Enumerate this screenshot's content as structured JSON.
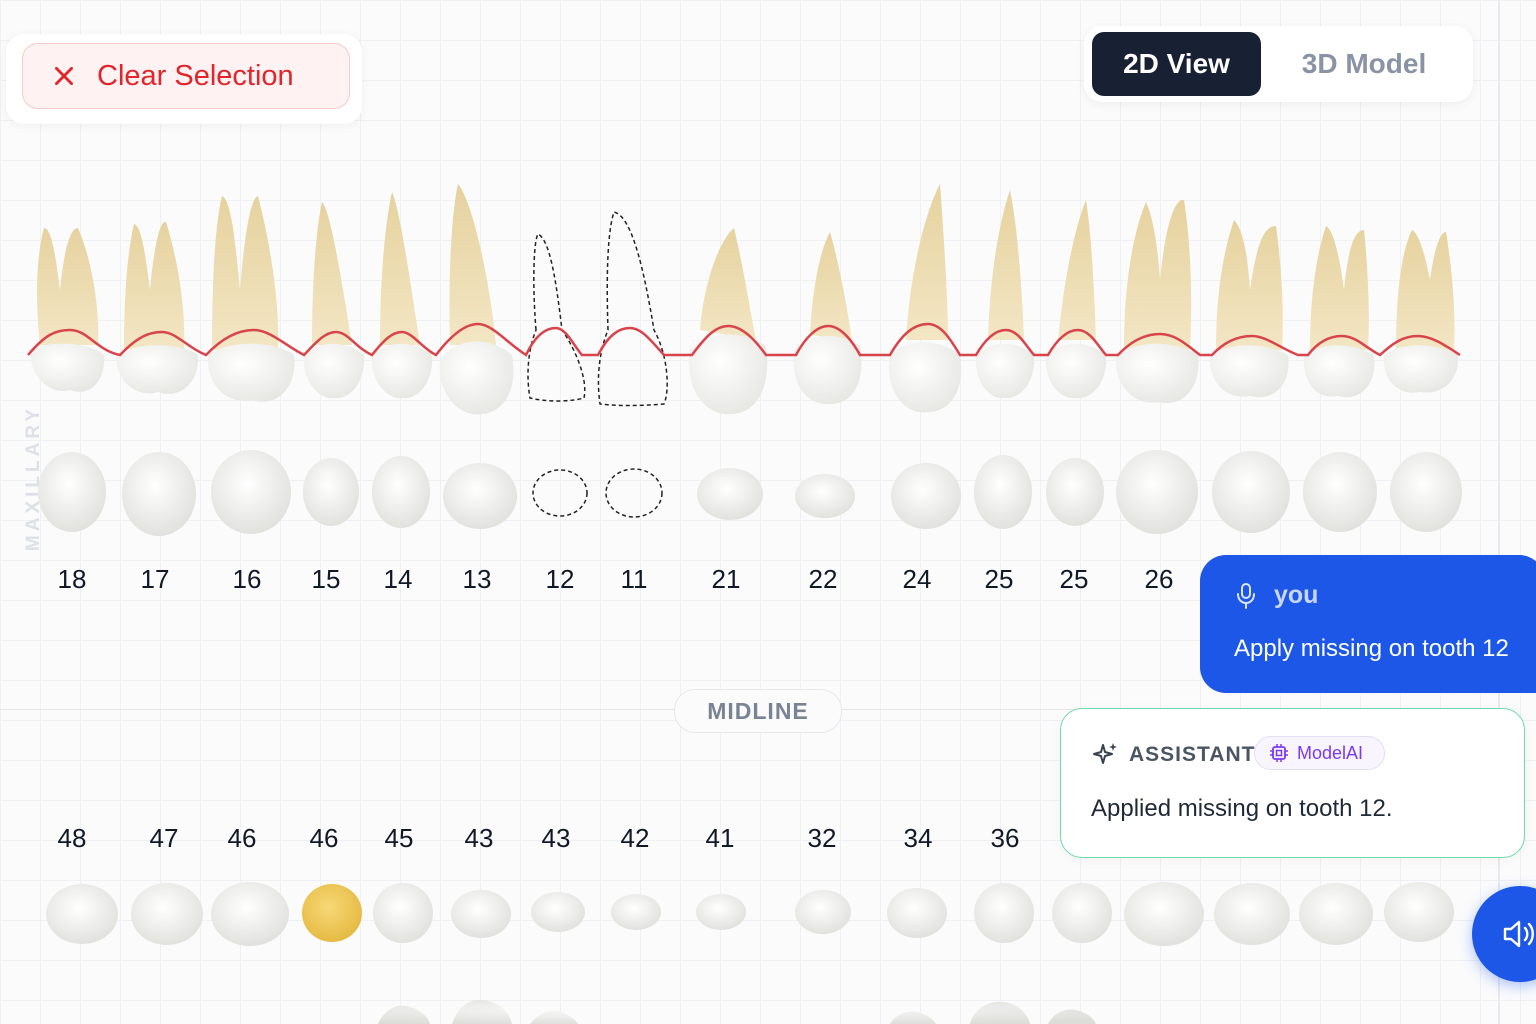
{
  "toolbar": {
    "clear_label": "Clear Selection"
  },
  "view_toggle": {
    "tabs": [
      "2D View",
      "3D Model"
    ],
    "active": "2D View"
  },
  "arch_label": "MAXILLARY",
  "midline_label": "MIDLINE",
  "upper_numbers": [
    "18",
    "17",
    "16",
    "15",
    "14",
    "13",
    "12",
    "11",
    "21",
    "22",
    "24",
    "25",
    "25",
    "26"
  ],
  "lower_numbers": [
    "48",
    "47",
    "46",
    "46",
    "45",
    "43",
    "43",
    "42",
    "41",
    "32",
    "34",
    "36"
  ],
  "missing_teeth": [
    "12",
    "11"
  ],
  "highlighted_tooth": "46",
  "chat": {
    "user": {
      "name": "you",
      "message": "Apply missing on tooth 12"
    },
    "assistant": {
      "role": "ASSISTANT",
      "model": "ModelAI",
      "message": "Applied missing on tooth 12."
    }
  },
  "colors": {
    "accent": "#1d57e8",
    "danger": "#e0262a",
    "gum_line": "#d9444a",
    "highlight": "#f2c94c",
    "root": "#ecdcb0"
  }
}
